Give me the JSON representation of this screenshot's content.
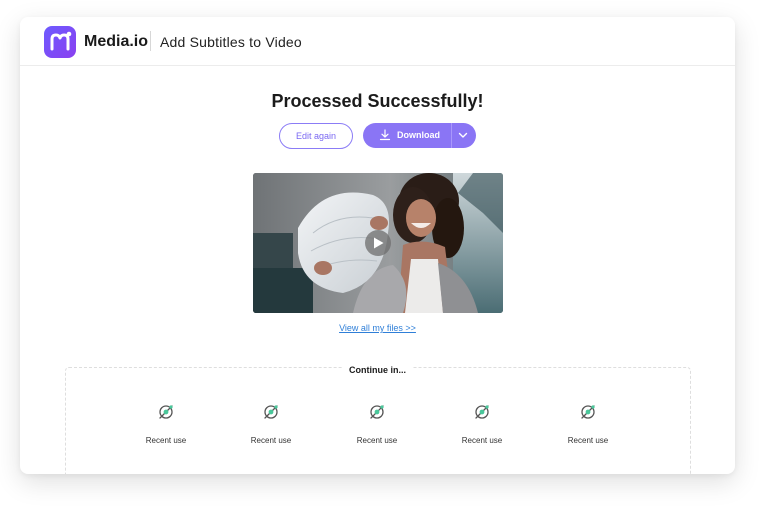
{
  "header": {
    "logo_text": "m",
    "brand": "Media.io",
    "title": "Add Subtitles to Video"
  },
  "main": {
    "heading": "Processed Successfully!",
    "edit_label": "Edit again",
    "download_label": "Download",
    "view_files_link": "View all my files >>"
  },
  "continue": {
    "title": "Continue in...",
    "items": [
      {
        "label": "Recent use",
        "icon": "recent-tool-icon"
      },
      {
        "label": "Recent use",
        "icon": "recent-tool-icon"
      },
      {
        "label": "Recent use",
        "icon": "recent-tool-icon"
      },
      {
        "label": "Recent use",
        "icon": "recent-tool-icon"
      },
      {
        "label": "Recent use",
        "icon": "recent-tool-icon"
      }
    ]
  },
  "colors": {
    "brand_gradient_start": "#6d5bff",
    "brand_gradient_end": "#8a3ff0",
    "accent": "#8a75f5",
    "link": "#2f7fd8",
    "recent_icon_green": "#49c79a"
  }
}
